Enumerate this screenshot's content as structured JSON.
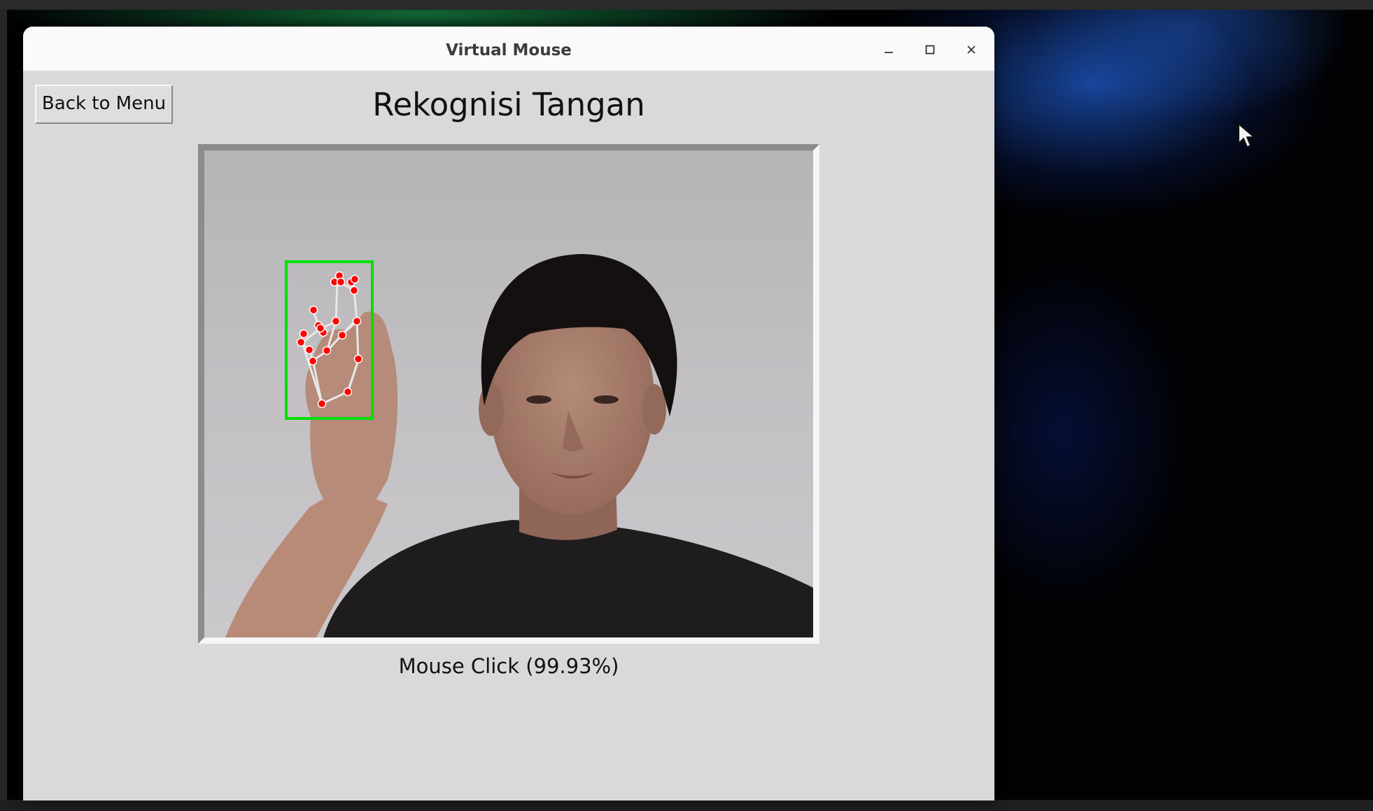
{
  "window": {
    "title": "Virtual Mouse",
    "controls": {
      "minimize_icon": "minimize-icon",
      "maximize_icon": "maximize-icon",
      "close_icon": "close-icon"
    }
  },
  "toolbar": {
    "back_label": "Back to Menu"
  },
  "main": {
    "page_title": "Rekognisi Tangan",
    "prediction": "Mouse Click (99.93%)"
  },
  "colors": {
    "window_bg": "#d9d9d9",
    "titlebar_bg": "#fafafa",
    "bbox_color": "#00e000",
    "landmark_color": "#ff0000",
    "connection_color": "#e8e8e8"
  }
}
